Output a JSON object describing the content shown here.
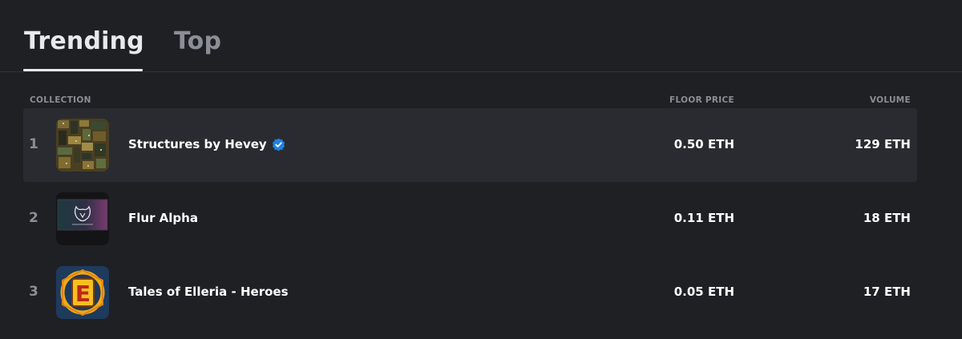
{
  "tabs": [
    {
      "label": "Trending",
      "active": true
    },
    {
      "label": "Top",
      "active": false
    }
  ],
  "table": {
    "headers": {
      "collection": "COLLECTION",
      "floor_price": "FLOOR PRICE",
      "volume": "VOLUME"
    },
    "rows": [
      {
        "rank": "1",
        "name": "Structures by Hevey",
        "verified": true,
        "floor_price": "0.50 ETH",
        "volume": "129 ETH",
        "thumb_icon": "structures-collection-thumbnail",
        "highlighted": true
      },
      {
        "rank": "2",
        "name": "Flur Alpha",
        "verified": false,
        "floor_price": "0.11 ETH",
        "volume": "18 ETH",
        "thumb_icon": "flur-alpha-collection-thumbnail",
        "thumb_text": "FLUR ALPHA",
        "highlighted": false
      },
      {
        "rank": "3",
        "name": "Tales of Elleria - Heroes",
        "verified": false,
        "floor_price": "0.05 ETH",
        "volume": "17 ETH",
        "thumb_icon": "elleria-e-logo-thumbnail",
        "thumb_text": "E",
        "highlighted": false
      }
    ]
  },
  "colors": {
    "background": "#1f2024",
    "highlight_row": "#2a2b30",
    "muted_text": "#8a8e96",
    "verified_blue": "#2081e2"
  }
}
